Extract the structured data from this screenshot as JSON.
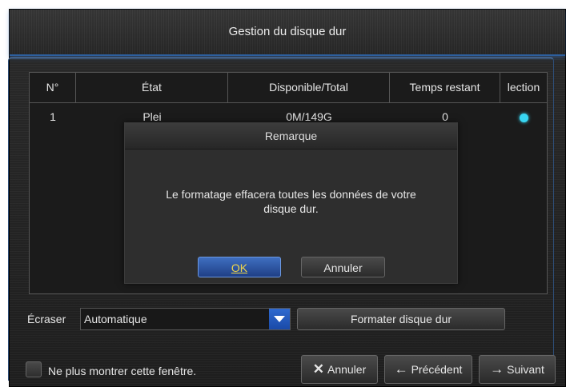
{
  "window": {
    "title": "Gestion du disque dur"
  },
  "table": {
    "headers": [
      "N°",
      "État",
      "Disponible/Total",
      "Temps restant",
      "lection"
    ],
    "rows": [
      {
        "num": "1",
        "state": "Plei",
        "available_total": "0M/149G",
        "time_left": "0",
        "selected": true
      }
    ]
  },
  "dialog": {
    "title": "Remarque",
    "message_line1": "Le formatage effacera toutes les données de votre",
    "message_line2": "disque dur.",
    "ok_label": "OK",
    "cancel_label": "Annuler"
  },
  "overwrite": {
    "label": "Écraser",
    "value": "Automatique"
  },
  "format_button": {
    "label": "Formater disque dur"
  },
  "footer": {
    "checkbox_label": "Ne plus montrer cette fenêtre.",
    "cancel_label": "Annuler",
    "previous_label": "Précédent",
    "next_label": "Suivant",
    "cancel_icon": "close-icon",
    "previous_icon": "arrow-left-icon",
    "next_icon": "arrow-right-icon"
  },
  "colors": {
    "accent": "#2d5f9e",
    "ok_text": "#f0d64a",
    "selected_dot": "#38d6f2"
  }
}
